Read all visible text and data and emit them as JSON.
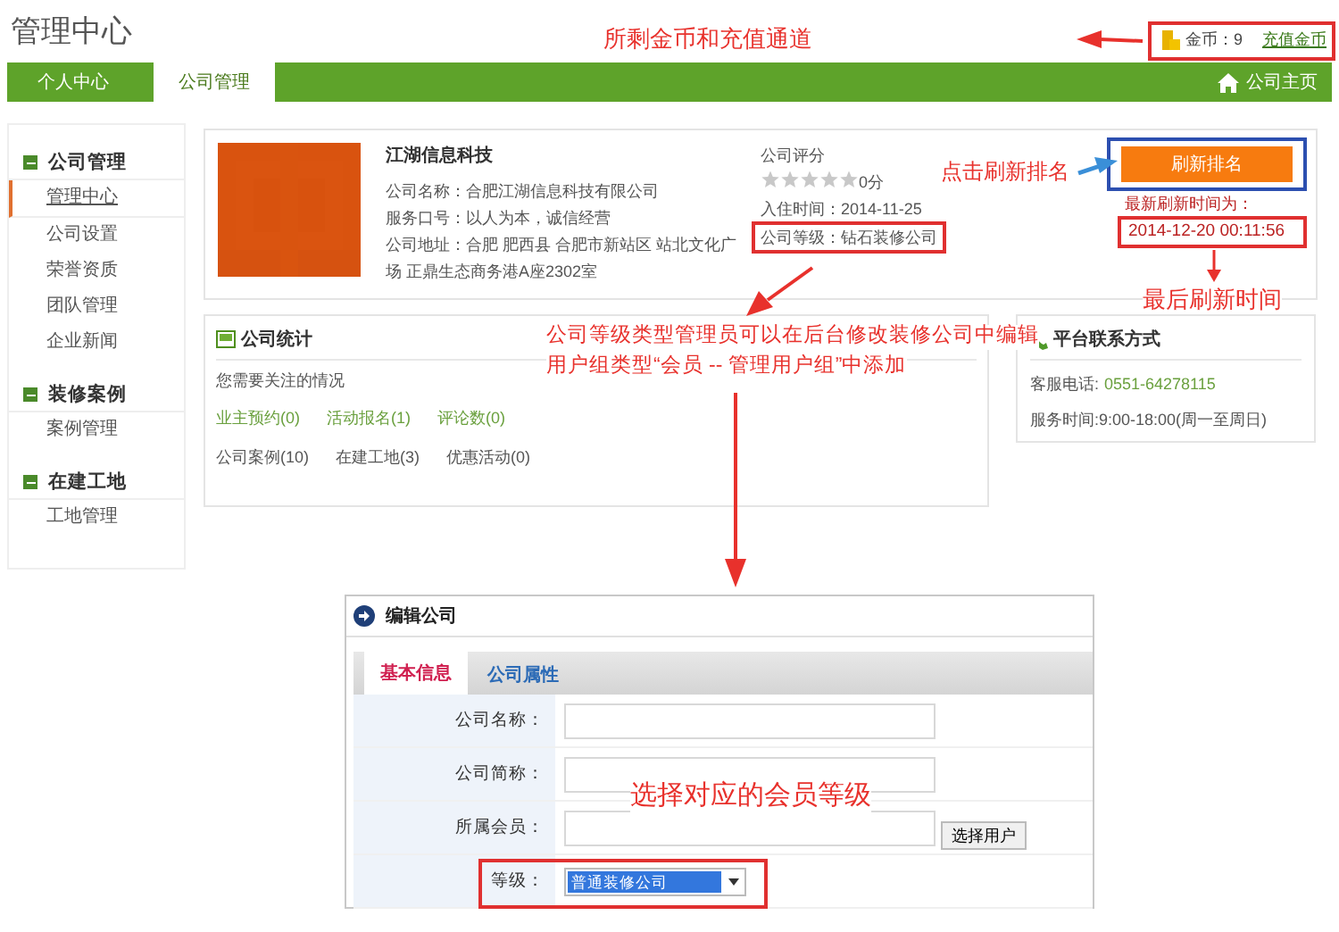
{
  "page_title": "管理中心",
  "account": {
    "coins": "金币：9",
    "recharge_link": "充值金币"
  },
  "nav": {
    "tabs": [
      {
        "label": "个人中心",
        "selected": false
      },
      {
        "label": "公司管理",
        "selected": true
      }
    ],
    "home_link": "公司主页"
  },
  "sidebar": {
    "sections": [
      {
        "title": "公司管理",
        "items": [
          {
            "label": "管理中心",
            "selected": true
          },
          {
            "label": "公司设置",
            "selected": false
          },
          {
            "label": "荣誉资质",
            "selected": false
          },
          {
            "label": "团队管理",
            "selected": false
          },
          {
            "label": "企业新闻",
            "selected": false
          }
        ]
      },
      {
        "title": "装修案例",
        "items": [
          {
            "label": "案例管理",
            "selected": false
          }
        ]
      },
      {
        "title": "在建工地",
        "items": [
          {
            "label": "工地管理",
            "selected": false
          }
        ]
      }
    ]
  },
  "company": {
    "name": "江湖信息科技",
    "details": [
      "公司名称：合肥江湖信息科技有限公司",
      "服务口号：以人为本，诚信经营",
      "公司地址：合肥 肥西县 合肥市新站区 站北文化广场 正鼎生态商务港A座2302室"
    ],
    "rating_label": "公司评分",
    "stars": 0,
    "score": "0分",
    "join_date": "入住时间：2014-11-25",
    "level": "公司等级：钻石装修公司"
  },
  "ranking": {
    "button": "刷新排名",
    "last_label": "最新刷新时间为：",
    "last_time": "2014-12-20 00:11:56"
  },
  "stats": {
    "title": "公司统计",
    "subtitle": "您需要关注的情况",
    "links": [
      "业主预约(0)",
      "活动报名(1)",
      "评论数(0)"
    ],
    "counts": [
      "公司案例(10)",
      "在建工地(3)",
      "优惠活动(0)"
    ]
  },
  "contact": {
    "title": "平台联系方式",
    "phone_label": "客服电话:",
    "phone": "0551-64278115",
    "hours": "服务时间:9:00-18:00(周一至周日)"
  },
  "edit_panel": {
    "title": "编辑公司",
    "tabs": [
      {
        "label": "基本信息",
        "selected": true
      },
      {
        "label": "公司属性",
        "selected": false
      }
    ],
    "fields": [
      {
        "kind": "text",
        "label": "公司名称："
      },
      {
        "kind": "text",
        "label": "公司简称："
      },
      {
        "kind": "text",
        "label": "所属会员：",
        "button": "选择用户"
      },
      {
        "kind": "select",
        "label": "等级：",
        "value": "普通装修公司"
      }
    ]
  },
  "annotations": [
    "所剩金币和充值通道",
    "点击刷新排名",
    "最后刷新时间",
    "公司等级类型管理员可以在后台修改装修公司中编辑",
    "用户组类型“会员 -- 管理用户组”中添加",
    "选择对应的会员等级"
  ]
}
